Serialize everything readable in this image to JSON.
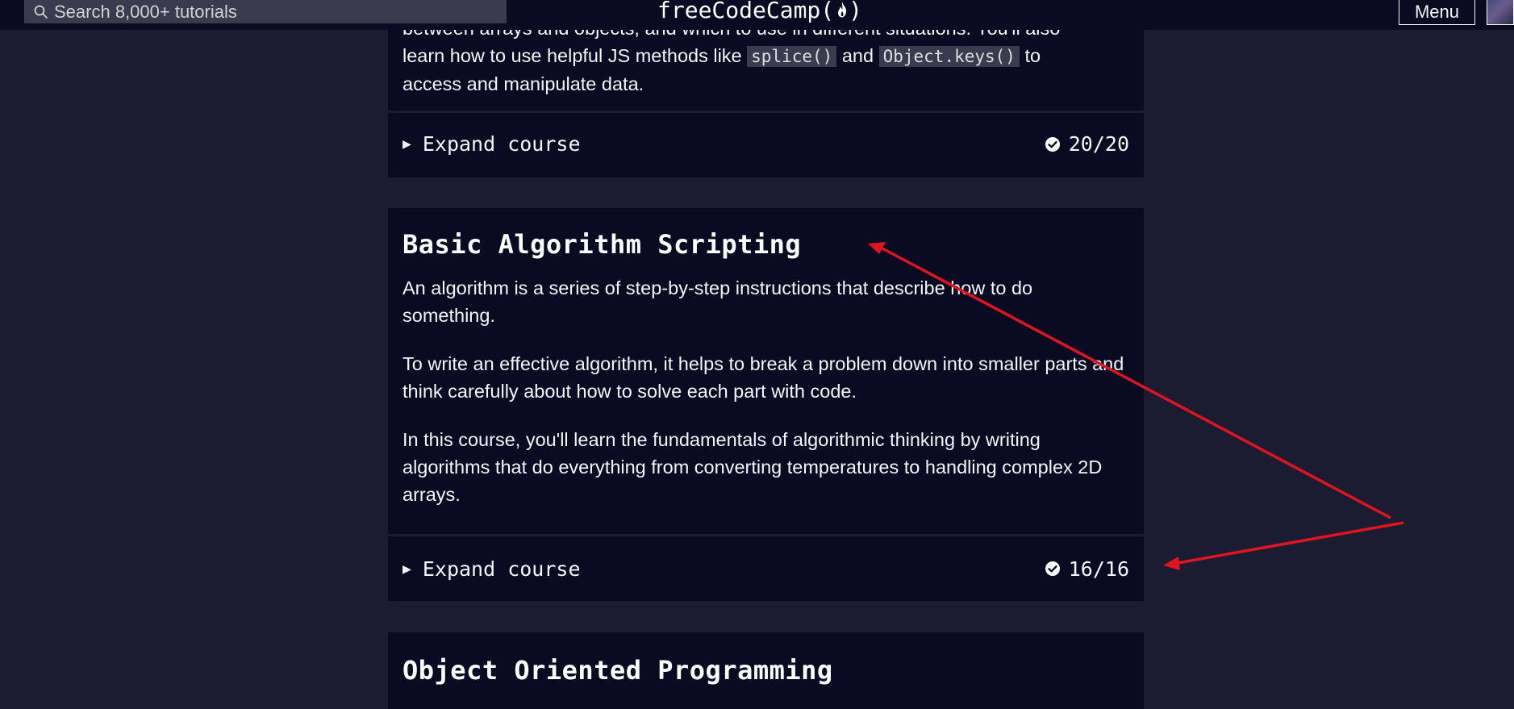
{
  "nav": {
    "search_placeholder": "Search 8,000+ tutorials",
    "logo_text": "freeCodeCamp(",
    "logo_close": ")",
    "menu_label": "Menu"
  },
  "blocks": [
    {
      "description_lines": [
        "between arrays and objects, and which to use in different situations. You'll also"
      ],
      "desc_prefix": "learn how to use helpful JS methods like",
      "code1": "splice()",
      "and_text": "and",
      "code2": "Object.keys()",
      "desc_suffix": "to",
      "desc_last": "access and manipulate data.",
      "expand_label": "Expand course",
      "progress": "20/20",
      "completed": 20,
      "total": 20
    },
    {
      "title": "Basic Algorithm Scripting",
      "paragraphs": [
        "An algorithm is a series of step-by-step instructions that describe how to do something.",
        "To write an effective algorithm, it helps to break a problem down into smaller parts and think carefully about how to solve each part with code.",
        "In this course, you'll learn the fundamentals of algorithmic thinking by writing algorithms that do everything from converting temperatures to handling complex 2D arrays."
      ],
      "expand_label": "Expand course",
      "progress": "16/16",
      "completed": 16,
      "total": 16
    },
    {
      "title": "Object Oriented Programming"
    }
  ],
  "colors": {
    "page_background": "#1b1b32",
    "block_background": "#0a0a23",
    "annotation_arrow": "#e0141e"
  },
  "icons": {
    "search": "search-icon",
    "flame": "flame-icon",
    "check": "check-circle-icon",
    "expand": "triangle-right-icon"
  }
}
